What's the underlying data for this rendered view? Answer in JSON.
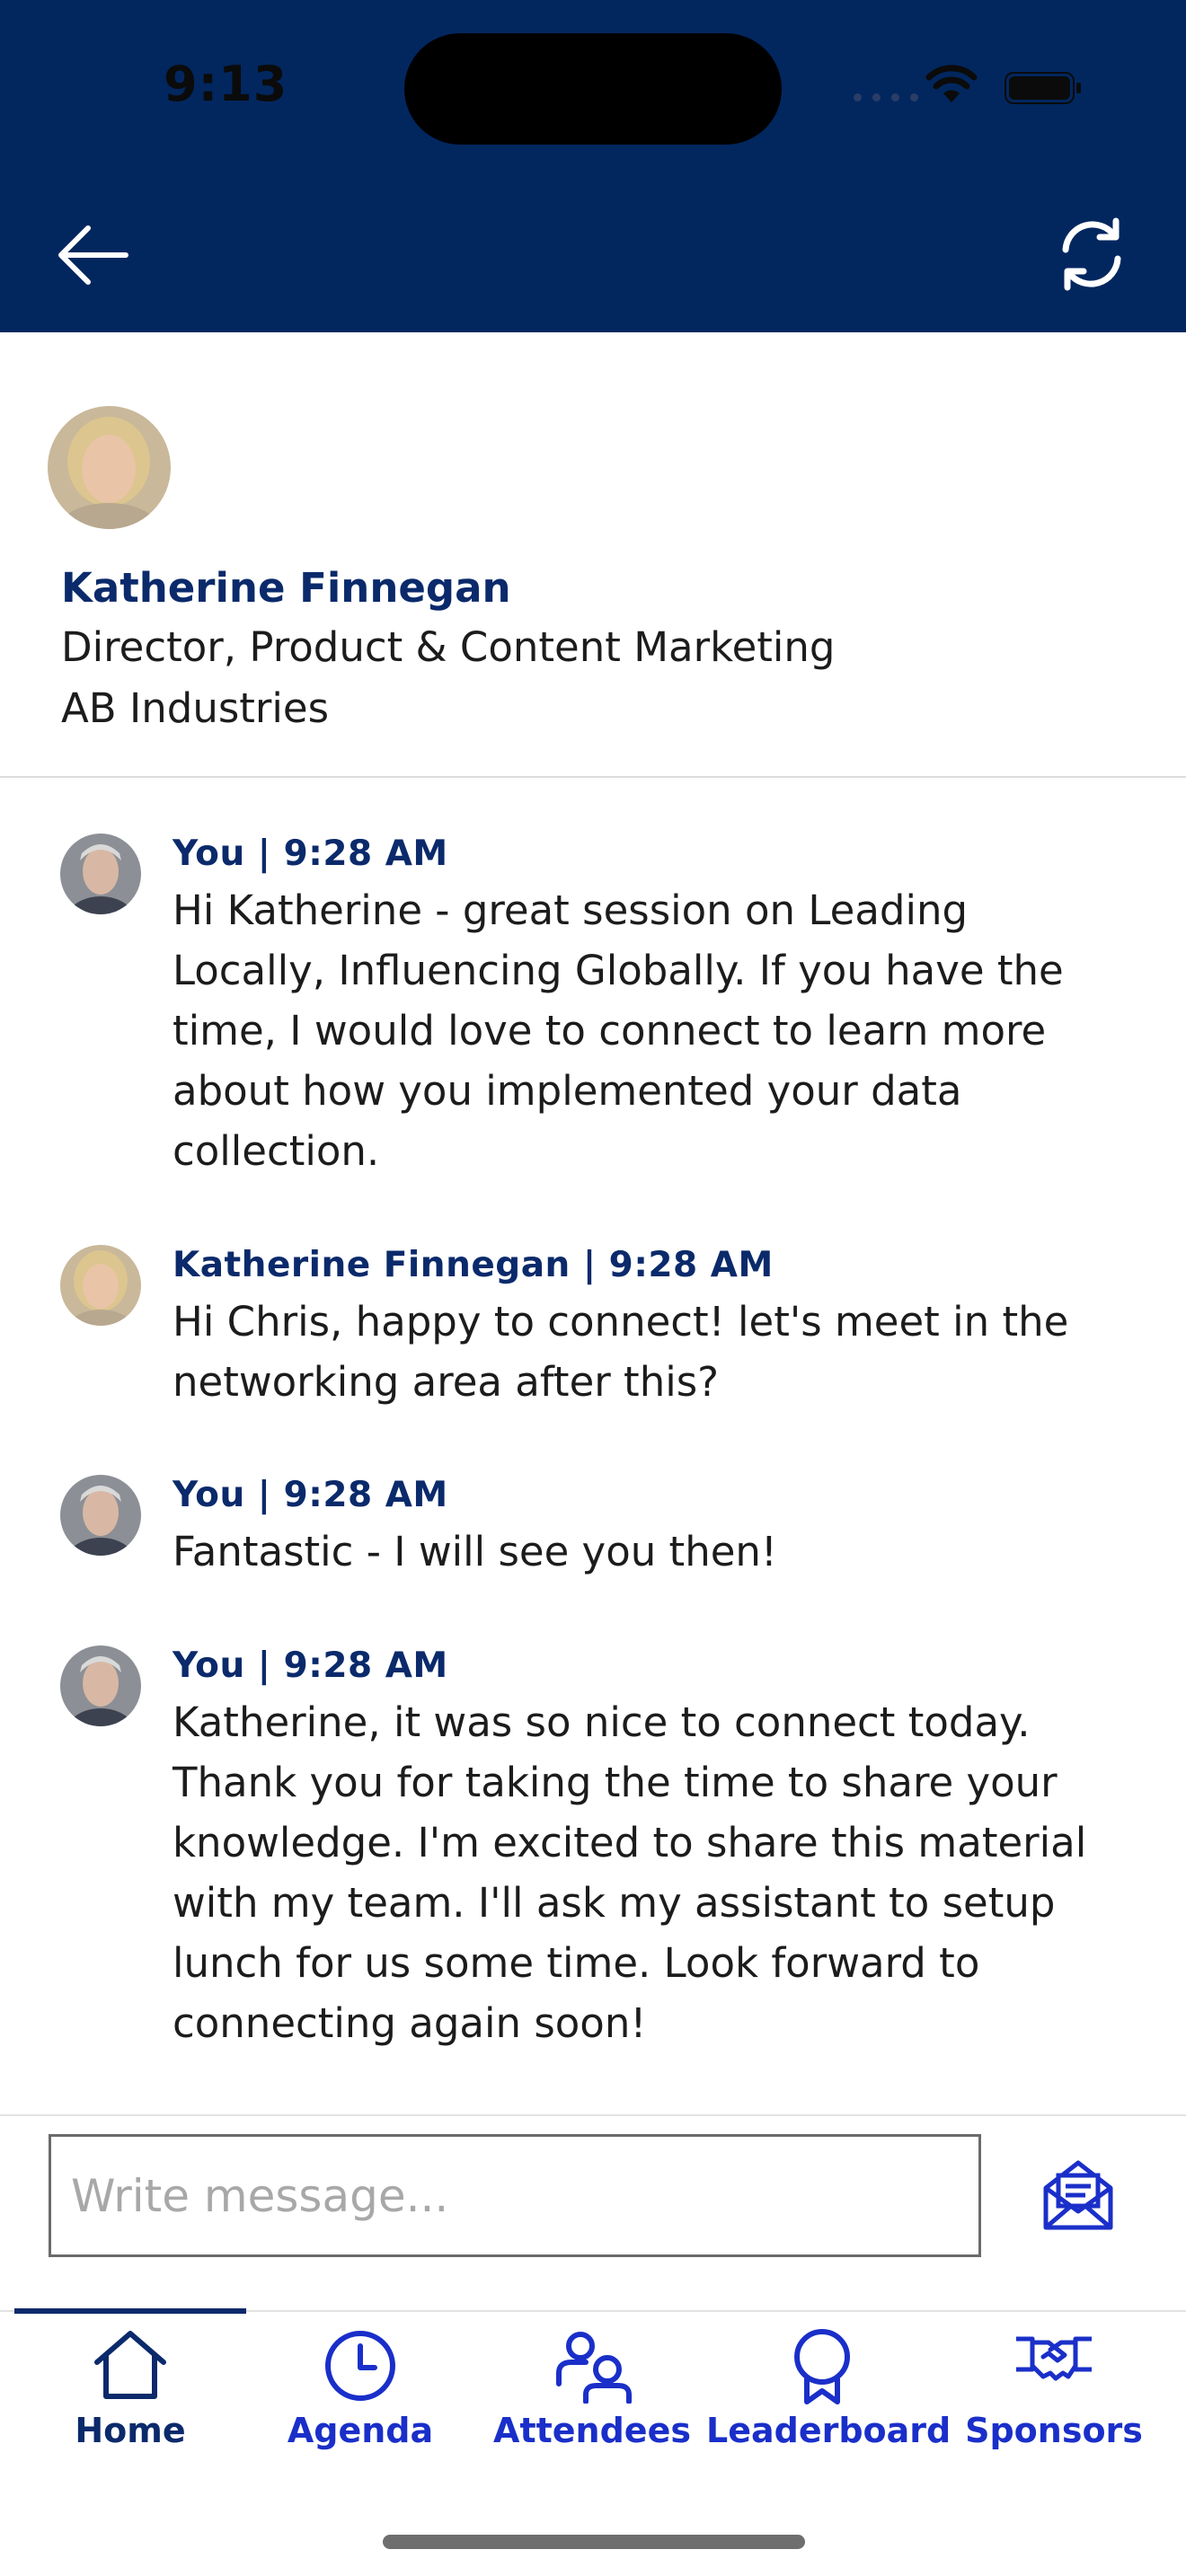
{
  "status_bar": {
    "time": "9:13"
  },
  "header": {
    "back_icon": "arrow-left-icon",
    "refresh_icon": "refresh-icon",
    "background": "#02275f"
  },
  "profile": {
    "name": "Katherine Finnegan",
    "title": "Director, Product & Content Marketing",
    "company": "AB Industries"
  },
  "messages": [
    {
      "meta": "You | 9:28 AM",
      "text": "Hi Katherine - great session on Leading Locally, Influencing Globally. If you have the time, I would love to connect to learn more about how you implemented your data collection."
    },
    {
      "meta": "Katherine Finnegan | 9:28 AM",
      "text": "Hi Chris, happy to connect! let's meet in the networking area after this?"
    },
    {
      "meta": "You | 9:28 AM",
      "text": "Fantastic - I will see you then!"
    },
    {
      "meta": "You | 9:28 AM",
      "text": "Katherine, it was so nice to connect today. Thank you for taking the time to share your knowledge. I'm excited to share this material with my team. I'll ask my assistant to setup lunch for us some time. Look forward to connecting again soon!"
    }
  ],
  "composer": {
    "placeholder": "Write message...",
    "value": "",
    "send_icon": "send-mail-icon"
  },
  "nav": {
    "items": [
      {
        "label": "Home",
        "icon": "home-icon",
        "active": true
      },
      {
        "label": "Agenda",
        "icon": "clock-icon",
        "active": false
      },
      {
        "label": "Attendees",
        "icon": "people-icon",
        "active": false
      },
      {
        "label": "Leaderboard",
        "icon": "ribbon-icon",
        "active": false
      },
      {
        "label": "Sponsors",
        "icon": "handshake-icon",
        "active": false
      }
    ]
  },
  "colors": {
    "brand_navy": "#02275f",
    "name_text": "#0b2a6b",
    "nav_blue": "#1a2fc9"
  }
}
